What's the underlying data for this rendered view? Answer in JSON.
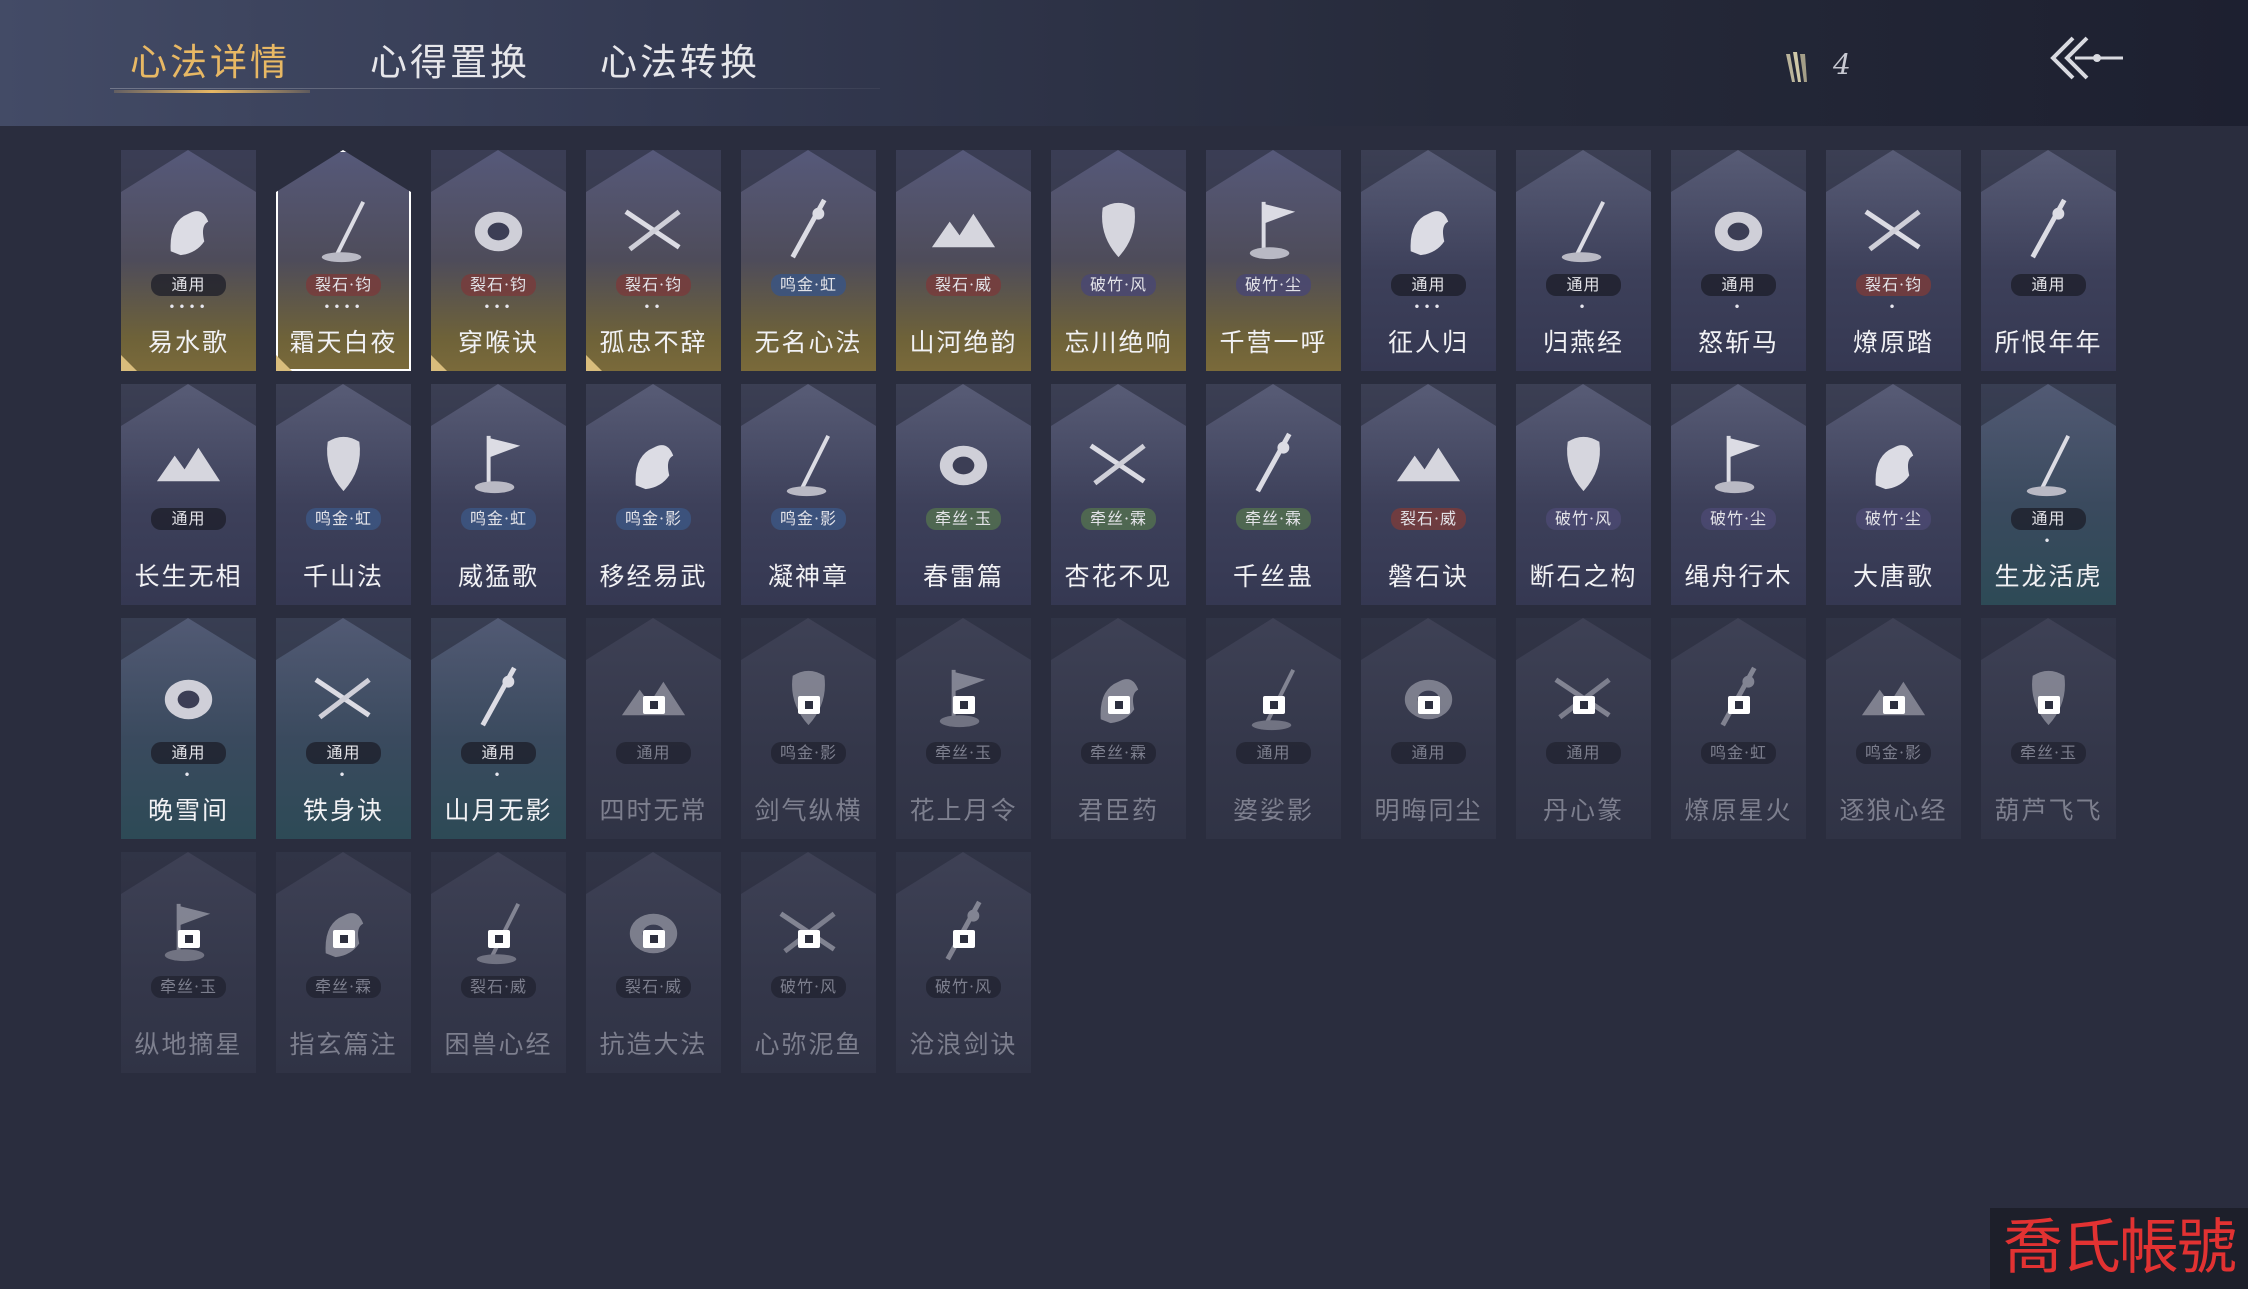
{
  "header": {
    "tabs": [
      {
        "label": "心法详情",
        "active": true
      },
      {
        "label": "心得置换",
        "active": false
      },
      {
        "label": "心法转换",
        "active": false
      }
    ],
    "currency_icon": "quill-bundle-icon",
    "currency_count": "4",
    "back_icon": "double-chevron-back-icon"
  },
  "cards": [
    {
      "name": "易水歌",
      "tag": "通用",
      "tag_color": "plain",
      "dots": "••••",
      "style": "gold",
      "corner": true,
      "icon": "horse-icon"
    },
    {
      "name": "霜天白夜",
      "tag": "裂石·钧",
      "tag_color": "red",
      "dots": "••••",
      "style": "gold",
      "corner": true,
      "selected": true,
      "icon": "sword-in-ground-icon"
    },
    {
      "name": "穿喉诀",
      "tag": "裂石·钧",
      "tag_color": "red",
      "dots": "•••",
      "style": "gold",
      "corner": true,
      "icon": "drum-icon"
    },
    {
      "name": "孤忠不辞",
      "tag": "裂石·钧",
      "tag_color": "red",
      "dots": "••",
      "style": "gold",
      "corner": true,
      "icon": "crossed-blades-icon"
    },
    {
      "name": "无名心法",
      "tag": "鸣金·虹",
      "tag_color": "blue",
      "dots": "",
      "style": "gold",
      "corner": false,
      "icon": "sword-icon"
    },
    {
      "name": "山河绝韵",
      "tag": "裂石·威",
      "tag_color": "red",
      "dots": "",
      "style": "gold",
      "corner": false,
      "icon": "mountains-icon"
    },
    {
      "name": "忘川绝响",
      "tag": "破竹·风",
      "tag_color": "purple",
      "dots": "",
      "style": "gold",
      "corner": false,
      "icon": "mask-icon"
    },
    {
      "name": "千营一呼",
      "tag": "破竹·尘",
      "tag_color": "purple",
      "dots": "",
      "style": "gold",
      "corner": false,
      "icon": "flag-icon"
    },
    {
      "name": "征人归",
      "tag": "通用",
      "tag_color": "plain",
      "dots": "•••",
      "style": "normal",
      "corner": false,
      "icon": "bird-hand-icon"
    },
    {
      "name": "归燕经",
      "tag": "通用",
      "tag_color": "plain",
      "dots": "•",
      "style": "normal",
      "corner": false,
      "icon": "swallows-icon"
    },
    {
      "name": "怒斩马",
      "tag": "通用",
      "tag_color": "plain",
      "dots": "•",
      "style": "normal",
      "corner": false,
      "icon": "blade-icon"
    },
    {
      "name": "燎原踏",
      "tag": "裂石·钧",
      "tag_color": "red",
      "dots": "•",
      "style": "normal",
      "corner": false,
      "icon": "rider-icon"
    },
    {
      "name": "所恨年年",
      "tag": "通用",
      "tag_color": "plain",
      "dots": "",
      "style": "normal",
      "corner": false,
      "icon": "reed-icon"
    },
    {
      "name": "长生无相",
      "tag": "通用",
      "tag_color": "plain",
      "dots": "",
      "style": "normal",
      "corner": false,
      "icon": "monk-icon"
    },
    {
      "name": "千山法",
      "tag": "鸣金·虹",
      "tag_color": "blue",
      "dots": "",
      "style": "normal",
      "corner": false,
      "icon": "peaks-icon"
    },
    {
      "name": "威猛歌",
      "tag": "鸣金·虹",
      "tag_color": "blue",
      "dots": "",
      "style": "normal",
      "corner": false,
      "icon": "prayer-hands-icon"
    },
    {
      "name": "移经易武",
      "tag": "鸣金·影",
      "tag_color": "blue",
      "dots": "",
      "style": "normal",
      "corner": false,
      "icon": "warrior-icon"
    },
    {
      "name": "凝神章",
      "tag": "鸣金·影",
      "tag_color": "blue",
      "dots": "",
      "style": "normal",
      "corner": false,
      "icon": "bow-icon"
    },
    {
      "name": "春雷篇",
      "tag": "牵丝·玉",
      "tag_color": "green",
      "dots": "",
      "style": "normal",
      "corner": false,
      "icon": "storm-tree-icon"
    },
    {
      "name": "杏花不见",
      "tag": "牵丝·霖",
      "tag_color": "green",
      "dots": "",
      "style": "normal",
      "corner": false,
      "icon": "blossom-icon"
    },
    {
      "name": "千丝蛊",
      "tag": "牵丝·霖",
      "tag_color": "green",
      "dots": "",
      "style": "normal",
      "corner": false,
      "icon": "leaf-icon"
    },
    {
      "name": "磐石诀",
      "tag": "裂石·威",
      "tag_color": "red",
      "dots": "",
      "style": "normal",
      "corner": false,
      "icon": "boulder-icon"
    },
    {
      "name": "断石之构",
      "tag": "破竹·风",
      "tag_color": "purple",
      "dots": "",
      "style": "normal",
      "corner": false,
      "icon": "swordsman-icon"
    },
    {
      "name": "绳舟行木",
      "tag": "破竹·尘",
      "tag_color": "purple",
      "dots": "",
      "style": "normal",
      "corner": false,
      "icon": "roots-icon"
    },
    {
      "name": "大唐歌",
      "tag": "破竹·尘",
      "tag_color": "purple",
      "dots": "",
      "style": "normal",
      "corner": false,
      "icon": "palace-icon"
    },
    {
      "name": "生龙活虎",
      "tag": "通用",
      "tag_color": "plain",
      "dots": "•",
      "style": "teal",
      "corner": false,
      "icon": "swirl-icon"
    },
    {
      "name": "晚雪间",
      "tag": "通用",
      "tag_color": "plain",
      "dots": "•",
      "style": "teal",
      "corner": false,
      "icon": "anchor-cross-icon"
    },
    {
      "name": "铁身诀",
      "tag": "通用",
      "tag_color": "plain",
      "dots": "•",
      "style": "teal",
      "corner": false,
      "icon": "muscle-icon"
    },
    {
      "name": "山月无影",
      "tag": "通用",
      "tag_color": "plain",
      "dots": "•",
      "style": "teal",
      "corner": false,
      "icon": "claw-marks-icon"
    },
    {
      "name": "四时无常",
      "tag": "通用",
      "tag_color": "plain",
      "dots": "",
      "style": "locked",
      "corner": false,
      "icon": "serpent-icon"
    },
    {
      "name": "剑气纵横",
      "tag": "鸣金·影",
      "tag_color": "plain",
      "dots": "",
      "style": "locked",
      "corner": false,
      "icon": "sword-swirl-icon"
    },
    {
      "name": "花上月令",
      "tag": "牵丝·玉",
      "tag_color": "plain",
      "dots": "",
      "style": "locked",
      "corner": false,
      "icon": "moon-flower-icon"
    },
    {
      "name": "君臣药",
      "tag": "牵丝·霖",
      "tag_color": "plain",
      "dots": "",
      "style": "locked",
      "corner": false,
      "icon": "herb-pot-icon"
    },
    {
      "name": "婆娑影",
      "tag": "通用",
      "tag_color": "plain",
      "dots": "",
      "style": "locked",
      "corner": false,
      "icon": "dragon-icon"
    },
    {
      "name": "明晦同尘",
      "tag": "通用",
      "tag_color": "plain",
      "dots": "",
      "style": "locked",
      "corner": false,
      "icon": "coiled-snake-icon"
    },
    {
      "name": "丹心篆",
      "tag": "通用",
      "tag_color": "plain",
      "dots": "",
      "style": "locked",
      "corner": false,
      "icon": "brush-icon"
    },
    {
      "name": "燎原星火",
      "tag": "鸣金·虹",
      "tag_color": "plain",
      "dots": "",
      "style": "locked",
      "corner": false,
      "icon": "scythe-icon"
    },
    {
      "name": "逐狼心经",
      "tag": "鸣金·影",
      "tag_color": "plain",
      "dots": "",
      "style": "locked",
      "corner": false,
      "icon": "wolf-icon"
    },
    {
      "name": "葫芦飞飞",
      "tag": "牵丝·玉",
      "tag_color": "plain",
      "dots": "",
      "style": "locked",
      "corner": false,
      "icon": "gourd-icon"
    },
    {
      "name": "纵地摘星",
      "tag": "牵丝·玉",
      "tag_color": "plain",
      "dots": "",
      "style": "locked",
      "corner": false,
      "icon": "star-orb-icon"
    },
    {
      "name": "指玄篇注",
      "tag": "牵丝·霖",
      "tag_color": "plain",
      "dots": "",
      "style": "locked",
      "corner": false,
      "icon": "yin-yang-icon"
    },
    {
      "name": "困兽心经",
      "tag": "裂石·威",
      "tag_color": "plain",
      "dots": "",
      "style": "locked",
      "corner": false,
      "icon": "beast-icon"
    },
    {
      "name": "抗造大法",
      "tag": "裂石·威",
      "tag_color": "plain",
      "dots": "",
      "style": "locked",
      "corner": false,
      "icon": "bell-icon"
    },
    {
      "name": "心弥泥鱼",
      "tag": "破竹·风",
      "tag_color": "plain",
      "dots": "",
      "style": "locked",
      "corner": false,
      "icon": "fish-icon"
    },
    {
      "name": "沧浪剑诀",
      "tag": "破竹·风",
      "tag_color": "plain",
      "dots": "",
      "style": "locked",
      "corner": false,
      "icon": "wave-dragon-icon"
    }
  ],
  "watermark": "喬氏帳號"
}
